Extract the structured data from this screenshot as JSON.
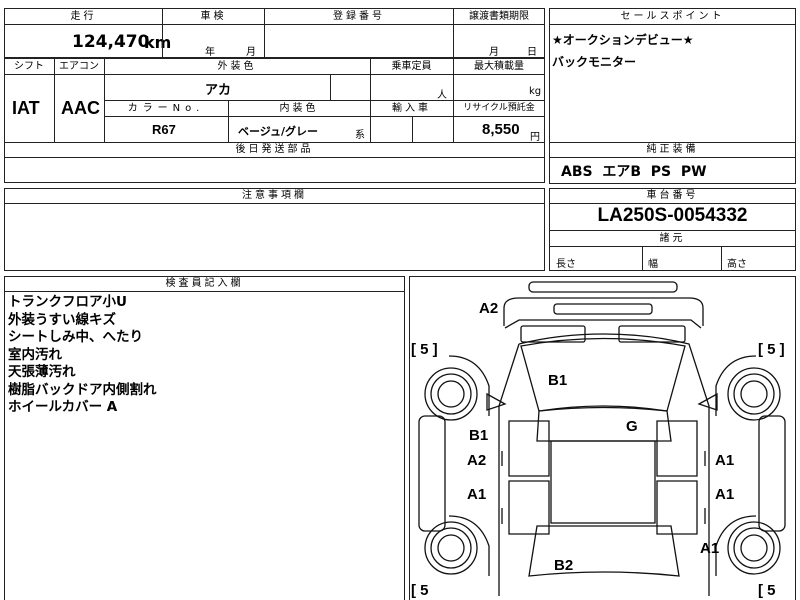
{
  "top": {
    "mileage_label": "走行",
    "mileage": "124,470",
    "mileage_unit": "km",
    "inspection_label": "車検",
    "year_unit": "年",
    "month_unit": "月",
    "registration_label": "登録番号",
    "transfer_label": "譲渡書類期限",
    "transfer_month": "月",
    "transfer_day": "日",
    "sales_point_label": "セールスポイント"
  },
  "spec": {
    "shift_label": "シフト",
    "shift": "IAT",
    "aircon_label": "エアコン",
    "aircon": "AAC",
    "exterior_label": "外装色",
    "exterior": "アカ",
    "capacity_label": "乗車定員",
    "capacity_unit": "人",
    "load_label": "最大積載量",
    "load_unit": "kg",
    "color_no_label": "カラーNo.",
    "color_no": "R67",
    "interior_label": "内装色",
    "interior": "ベージュ/グレー",
    "interior_suffix": "系",
    "import_label": "輸入車",
    "recycle_label": "リサイクル預託金",
    "recycle": "8,550",
    "recycle_unit": "円",
    "parts_label": "後日発送部品"
  },
  "sales_points": [
    "★オークションデビュー★",
    "バックモニター"
  ],
  "equipment_label": "純正装備",
  "equipment": "ABS  エアB  PS  PW",
  "notes_label": "注意事項欄",
  "chassis_label": "車台番号",
  "chassis": "LA250S-0054332",
  "dims_label": "諸元",
  "dims": {
    "length": "長さ",
    "width": "幅",
    "height": "高さ"
  },
  "inspector_label": "検査員記入欄",
  "inspector_notes": [
    "トランクフロア小U",
    "外装うすい線キズ",
    "シートしみ中、へたり",
    "室内汚れ",
    "天張薄汚れ",
    "樹脂バックドア内側割れ",
    "ホイールカバー A"
  ],
  "diagram": {
    "marks": [
      "A2",
      "B1",
      "G",
      "B1",
      "A2",
      "A1",
      "A1",
      "A1",
      "A1",
      "B2"
    ],
    "brackets": [
      "[ 5 ]",
      "[ 5 ]",
      "[ 5",
      "[ 5"
    ]
  }
}
